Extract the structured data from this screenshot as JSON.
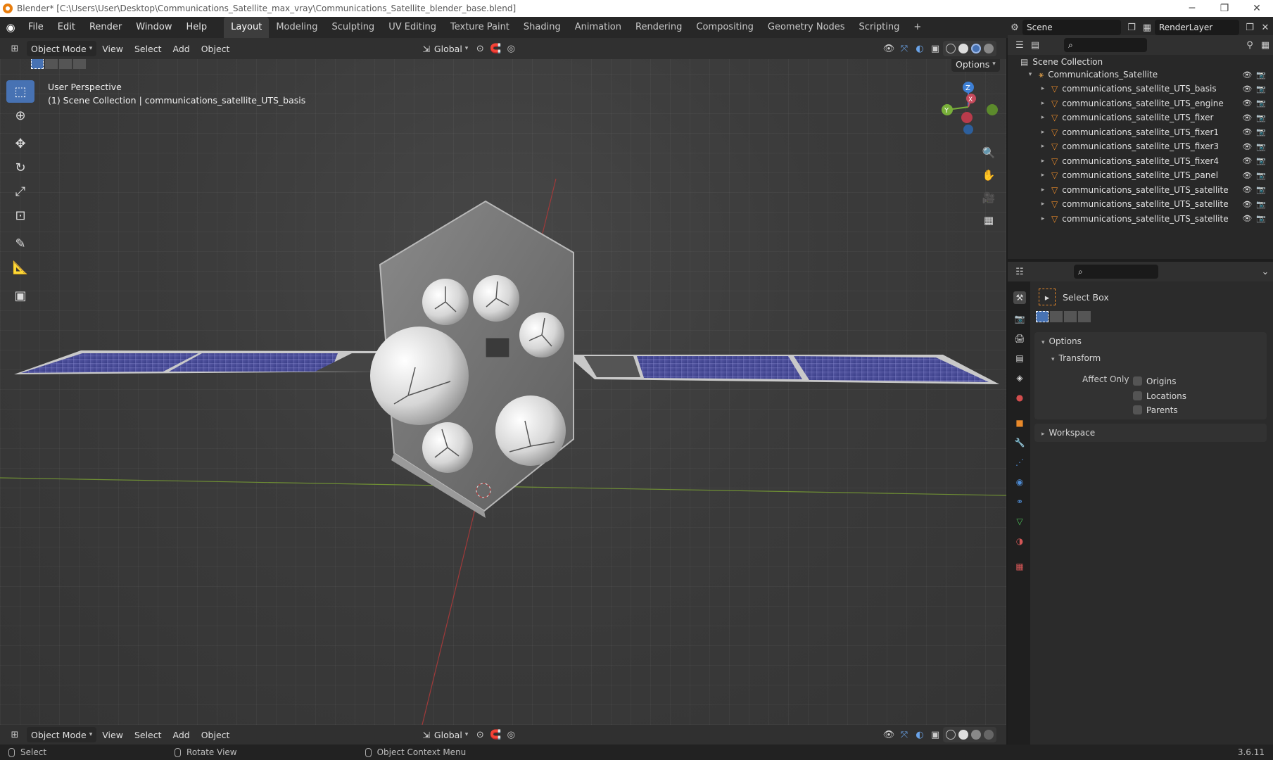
{
  "window": {
    "title": "Blender* [C:\\Users\\User\\Desktop\\Communications_Satellite_max_vray\\Communications_Satellite_blender_base.blend]",
    "minimize": "─",
    "maximize": "❐",
    "close": "✕"
  },
  "menu": {
    "items": [
      "File",
      "Edit",
      "Render",
      "Window",
      "Help"
    ]
  },
  "workspaces": [
    "Layout",
    "Modeling",
    "Sculpting",
    "UV Editing",
    "Texture Paint",
    "Shading",
    "Animation",
    "Rendering",
    "Compositing",
    "Geometry Nodes",
    "Scripting"
  ],
  "add_workspace": "+",
  "scene": {
    "name": "Scene",
    "render_layer": "RenderLayer"
  },
  "header3d": {
    "mode": "Object Mode",
    "view": "View",
    "select": "Select",
    "add": "Add",
    "object": "Object",
    "orientation": "Global",
    "options": "Options"
  },
  "viewport": {
    "perspective": "User Perspective",
    "collection_info": "(1) Scene Collection | communications_satellite_UTS_basis"
  },
  "gizmo": {
    "z": "Z",
    "y": "Y",
    "x": "X"
  },
  "outliner": {
    "root": "Scene Collection",
    "collection": "Communications_Satellite",
    "objects": [
      "communications_satellite_UTS_basis",
      "communications_satellite_UTS_engine",
      "communications_satellite_UTS_fixer",
      "communications_satellite_UTS_fixer1",
      "communications_satellite_UTS_fixer3",
      "communications_satellite_UTS_fixer4",
      "communications_satellite_UTS_panel",
      "communications_satellite_UTS_satellite",
      "communications_satellite_UTS_satellite",
      "communications_satellite_UTS_satellite"
    ]
  },
  "properties": {
    "tool_name": "Select Box",
    "options_label": "Options",
    "transform_label": "Transform",
    "affect_only": "Affect Only",
    "checks": [
      "Origins",
      "Locations",
      "Parents"
    ],
    "workspace_label": "Workspace"
  },
  "status": {
    "select": "Select",
    "rotate": "Rotate View",
    "context": "Object Context Menu",
    "version": "3.6.11"
  }
}
